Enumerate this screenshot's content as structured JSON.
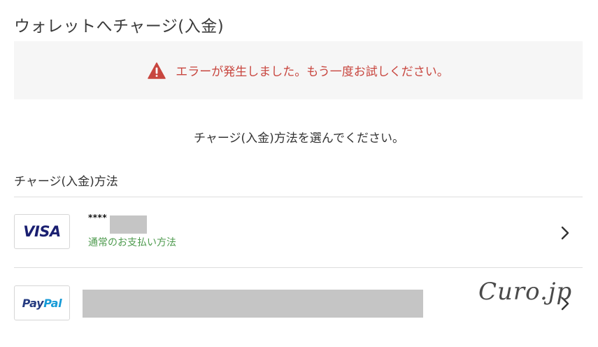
{
  "page": {
    "title": "ウォレットへチャージ(入金)"
  },
  "alert": {
    "icon": "warning-icon",
    "message": "エラーが発生しました。もう一度お試しください。",
    "color": "#c8463f",
    "background": "#f6f6f6"
  },
  "instruction": "チャージ(入金)方法を選んでください。",
  "section": {
    "title": "チャージ(入金)方法"
  },
  "methods": [
    {
      "logo": "VISA",
      "number_masked": "****",
      "subtitle": "通常のお支払い方法",
      "subtitle_color": "#4d9a4d",
      "icon": "chevron-right-icon"
    },
    {
      "logo_parts": [
        "Pay",
        "Pal"
      ],
      "icon": "chevron-right-icon"
    }
  ],
  "watermark": "Curo.jp",
  "colors": {
    "visa_blue": "#1a1f71",
    "visa_gold": "#f7b600",
    "paypal_dark": "#253b80",
    "paypal_light": "#179bd7",
    "redaction": "#c5c5c5"
  }
}
